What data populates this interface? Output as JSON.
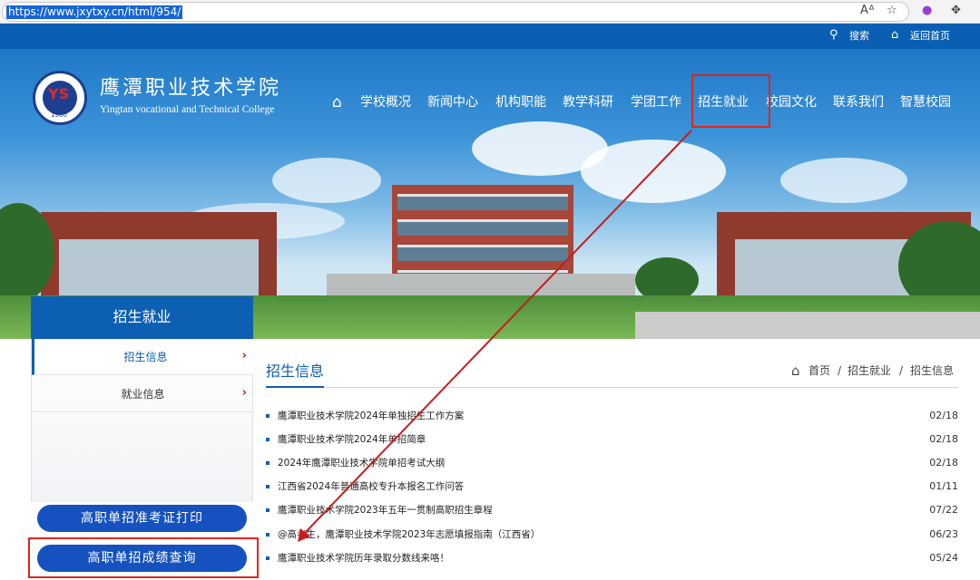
{
  "browser": {
    "url": "https://www.jxytxy.cn/html/954/",
    "icons": [
      "read-aloud-icon",
      "favorite-star-icon",
      "copilot-icon",
      "extensions-icon"
    ]
  },
  "util_bar": {
    "search_label": "搜索",
    "home_label": "返回首页"
  },
  "brand": {
    "name_cn": "鹰潭职业技术学院",
    "name_en": "Yingtan vocational and Technical College",
    "logo_text": "YS",
    "logo_year": "1960"
  },
  "nav": {
    "items": [
      {
        "label": "学校概况"
      },
      {
        "label": "新闻中心"
      },
      {
        "label": "机构职能"
      },
      {
        "label": "教学科研"
      },
      {
        "label": "学团工作"
      },
      {
        "label": "招生就业"
      },
      {
        "label": "校园文化"
      },
      {
        "label": "联系我们"
      },
      {
        "label": "智慧校园"
      }
    ]
  },
  "sidebar": {
    "title": "招生就业",
    "items": [
      {
        "label": "招生信息",
        "active": true
      },
      {
        "label": "就业信息",
        "active": false
      }
    ],
    "buttons": [
      {
        "label": "高职单招准考证打印"
      },
      {
        "label": "高职单招成绩查询"
      }
    ]
  },
  "content": {
    "title": "招生信息",
    "breadcrumb": {
      "home": "首页",
      "sep1": "/",
      "section": "招生就业",
      "sep2": "/",
      "current": "招生信息"
    },
    "news": [
      {
        "title": "鹰潭职业技术学院2024年单独招生工作方案",
        "date": "02/18"
      },
      {
        "title": "鹰潭职业技术学院2024年单招简章",
        "date": "02/18"
      },
      {
        "title": "2024年鹰潭职业技术学院单招考试大纲",
        "date": "02/18"
      },
      {
        "title": "江西省2024年普通高校专升本报名工作问答",
        "date": "01/11"
      },
      {
        "title": "鹰潭职业技术学院2023年五年一贯制高职招生章程",
        "date": "07/22"
      },
      {
        "title": "@高考生，鹰潭职业技术学院2023年志愿填报指南（江西省）",
        "date": "06/23"
      },
      {
        "title": "鹰潭职业技术学院历年录取分数线来咯！",
        "date": "05/24"
      }
    ]
  },
  "colors": {
    "primary": "#0d5fb4",
    "button": "#1552c0",
    "annotation": "#e2231a",
    "arrow": "#c41e1e"
  }
}
